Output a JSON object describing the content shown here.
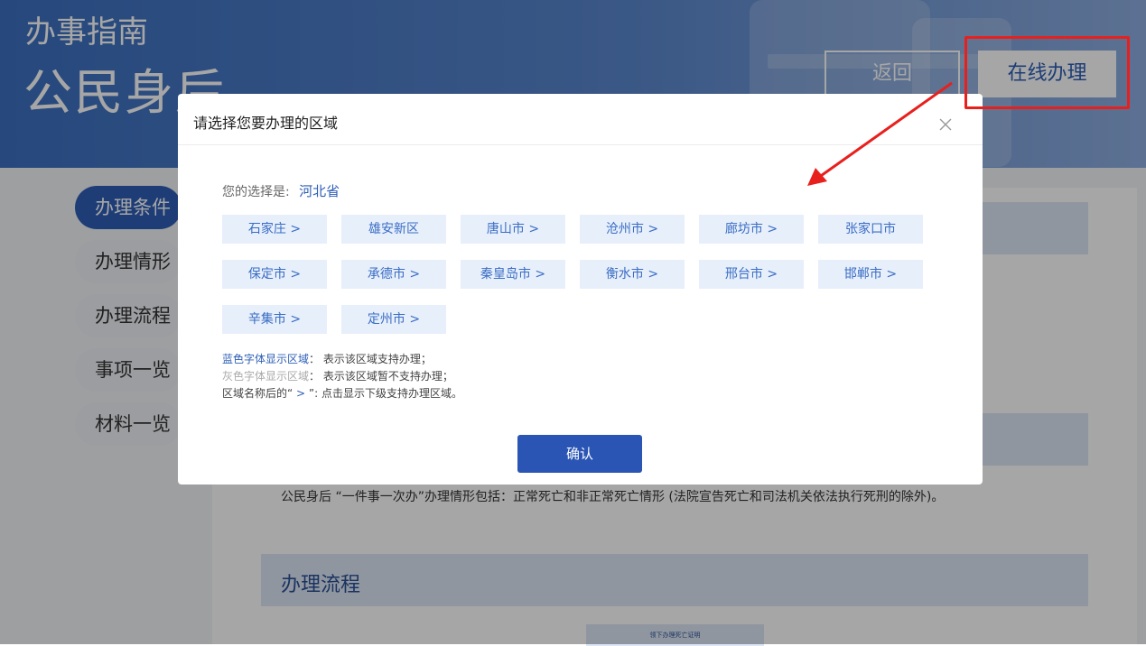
{
  "header": {
    "subtitle": "办事指南",
    "title": "公民身后",
    "back_label": "返回",
    "online_label": "在线办理"
  },
  "sidebar": {
    "items": [
      {
        "label": "办理条件"
      },
      {
        "label": "办理情形"
      },
      {
        "label": "办理流程"
      },
      {
        "label": "事项一览"
      },
      {
        "label": "材料一览"
      }
    ]
  },
  "content": {
    "situation_text": "公民身后 “一件事一次办”办理情形包括：正常死亡和非正常死亡情形 (法院宣告死亡和司法机关依法执行死刑的除外)。",
    "flow_section_title": "办理流程",
    "flow_box_label": "领下办理死亡证明"
  },
  "modal": {
    "title": "请选择您要办理的区域",
    "selection_label": "您的选择是:",
    "selection_value": "河北省",
    "regions": [
      "石家庄 >",
      "雄安新区",
      "唐山市 >",
      "沧州市 >",
      "廊坊市 >",
      "张家口市",
      "保定市 >",
      "承德市 >",
      "秦皇岛市 >",
      "衡水市 >",
      "邢台市 >",
      "邯郸市 >",
      "辛集市 >",
      "定州市 >"
    ],
    "legend": {
      "blue_term": "蓝色字体显示区域",
      "blue_desc": "： 表示该区域支持办理；",
      "gray_term": "灰色字体显示区域",
      "gray_desc": "： 表示该区域暂不支持办理；",
      "arrow_prefix": "区域名称后的“",
      "arrow_symbol": " > ",
      "arrow_desc": "”: 点击显示下级支持办理区域。"
    },
    "confirm_label": "确认"
  },
  "colors": {
    "accent": "#2a55b5",
    "annotation": "#e8201d",
    "region_bg": "#e7effb"
  }
}
